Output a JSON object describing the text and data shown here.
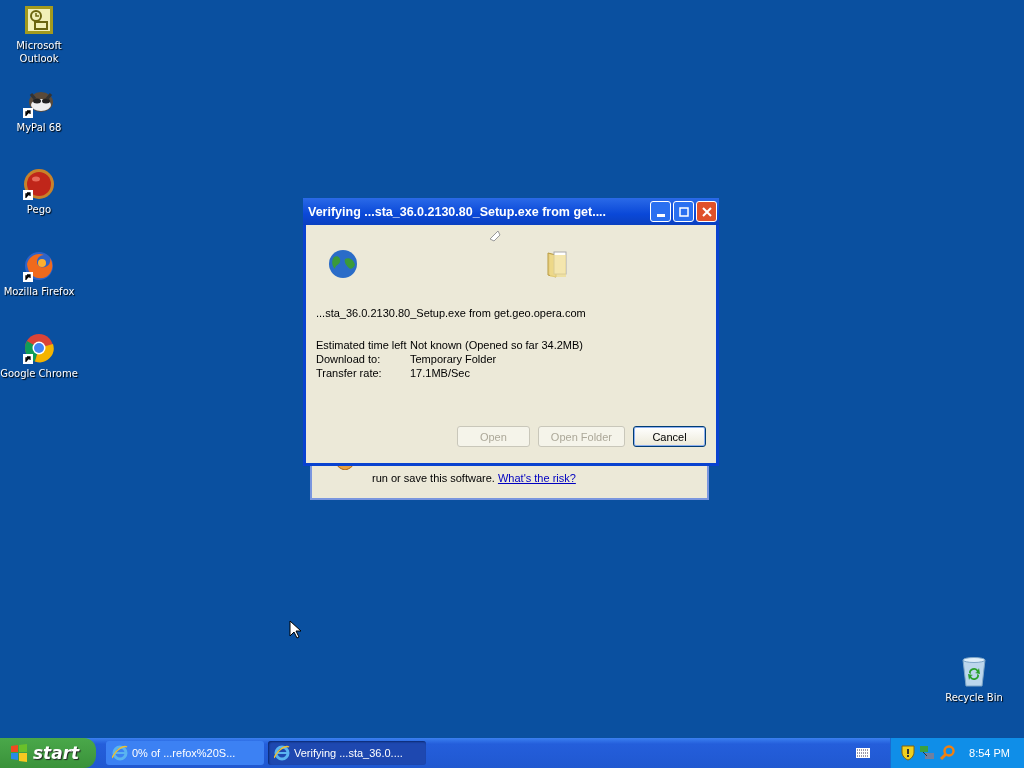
{
  "desktop_icons": [
    {
      "kind": "outlook",
      "label": "Microsoft Outlook",
      "shortcut": false
    },
    {
      "kind": "raccoon",
      "label": "MyPal 68",
      "shortcut": true
    },
    {
      "kind": "redball",
      "label": "Pego",
      "shortcut": true
    },
    {
      "kind": "firefox",
      "label": "Mozilla Firefox",
      "shortcut": true
    },
    {
      "kind": "chrome",
      "label": "Google Chrome",
      "shortcut": true
    },
    {
      "kind": "recycle",
      "label": "Recycle Bin",
      "shortcut": false
    }
  ],
  "background_window": {
    "text": "run or save this software.",
    "link": "What's the risk?"
  },
  "dialog": {
    "title": "Verifying ...sta_36.0.2130.80_Setup.exe from get....",
    "file_line": "...sta_36.0.2130.80_Setup.exe from get.geo.opera.com",
    "details": [
      {
        "label": "Estimated time left",
        "value": "Not known (Opened so far 34.2MB)"
      },
      {
        "label": "Download to:",
        "value": "Temporary Folder"
      },
      {
        "label": "Transfer rate:",
        "value": "17.1MB/Sec"
      }
    ],
    "buttons": [
      {
        "label": "Open",
        "disabled": true,
        "default": false
      },
      {
        "label": "Open Folder",
        "disabled": true,
        "default": false
      },
      {
        "label": "Cancel",
        "disabled": false,
        "default": true
      }
    ]
  },
  "taskbar": {
    "start": "start",
    "tasks": [
      {
        "label": "0% of ...refox%20S...",
        "selected": false
      },
      {
        "label": "Verifying ...sta_36.0....",
        "selected": true
      }
    ],
    "clock": "8:54 PM"
  }
}
